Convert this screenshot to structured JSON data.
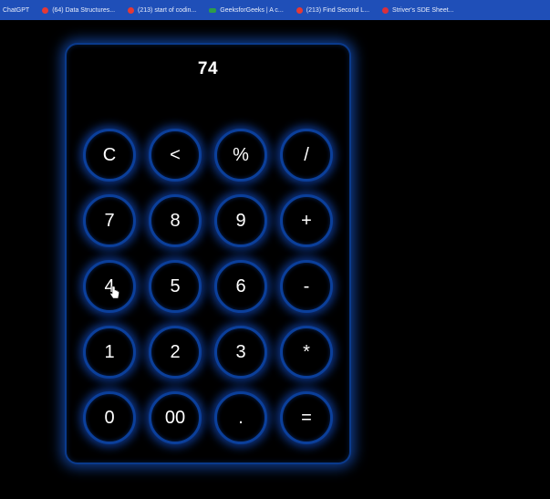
{
  "bookmarks": [
    {
      "label": "ChatGPT",
      "icon": "plain"
    },
    {
      "label": "(64) Data Structures...",
      "icon": "yt"
    },
    {
      "label": "(213) start of codin...",
      "icon": "yt"
    },
    {
      "label": "GeeksforGeeks | A c...",
      "icon": "gfg"
    },
    {
      "label": "(213) Find Second L...",
      "icon": "yt"
    },
    {
      "label": "Striver's SDE Sheet...",
      "icon": "striver"
    }
  ],
  "calculator": {
    "display_value": "74",
    "keys": [
      "C",
      "<",
      "%",
      "/",
      "7",
      "8",
      "9",
      "+",
      "4",
      "5",
      "6",
      "-",
      "1",
      "2",
      "3",
      "*",
      "0",
      "00",
      ".",
      "="
    ]
  },
  "colors": {
    "background": "#000000",
    "glow": "#1e6eff",
    "border": "#0b3f9a",
    "text": "#ffffff",
    "bookmarks_bar": "#1f4fb8"
  }
}
